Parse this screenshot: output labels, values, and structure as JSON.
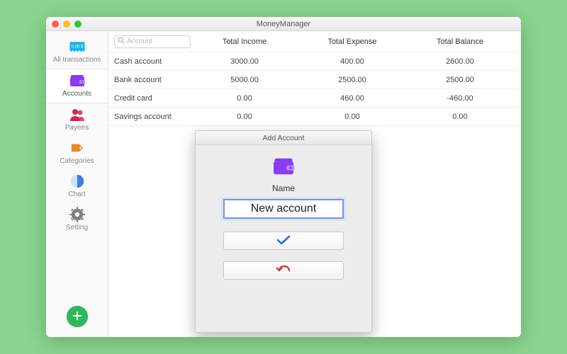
{
  "window": {
    "title": "MoneyManager"
  },
  "sidebar": {
    "items": [
      {
        "label": "All transactions",
        "icon": "receipt-icon",
        "color": "#19b3e6"
      },
      {
        "label": "Accounts",
        "icon": "wallet-icon",
        "color": "#8a3cf0"
      },
      {
        "label": "Payees",
        "icon": "people-icon",
        "color": "#c72f52"
      },
      {
        "label": "Categories",
        "icon": "tag-icon",
        "color": "#ea8a2a"
      },
      {
        "label": "Chart",
        "icon": "piechart-icon",
        "color": "#3b7de0"
      },
      {
        "label": "Setting",
        "icon": "gear-icon",
        "color": "#808080"
      }
    ],
    "selected_index": 1,
    "receipt_text": "0.00 $"
  },
  "search": {
    "placeholder": "Account"
  },
  "table": {
    "headers": [
      "Total Income",
      "Total Expense",
      "Total Balance"
    ],
    "rows": [
      {
        "name": "Cash account",
        "income": "3000.00",
        "expense": "400.00",
        "balance": "2600.00"
      },
      {
        "name": "Bank account",
        "income": "5000.00",
        "expense": "2500.00",
        "balance": "2500.00"
      },
      {
        "name": "Credit card",
        "income": "0.00",
        "expense": "460.00",
        "balance": "-460.00"
      },
      {
        "name": "Savings account",
        "income": "0.00",
        "expense": "0.00",
        "balance": "0.00"
      }
    ]
  },
  "modal": {
    "title": "Add Account",
    "name_label": "Name",
    "name_value": "New account",
    "confirm_icon": "check-icon",
    "cancel_icon": "undo-icon"
  },
  "colors": {
    "background": "#89d58e",
    "accent_purple": "#8a3cf0",
    "confirm_blue": "#2b6fd8",
    "cancel_red": "#c8433a",
    "add_green": "#2fb75c"
  }
}
